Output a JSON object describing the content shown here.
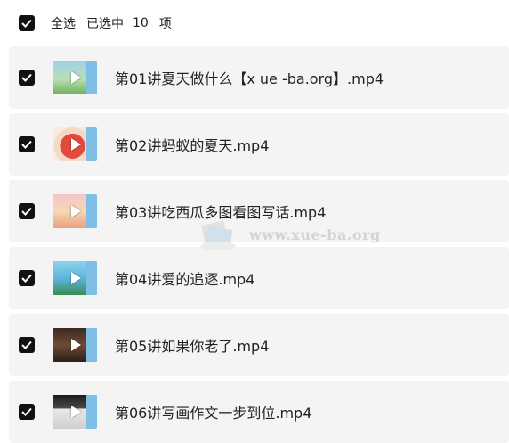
{
  "header": {
    "select_all_label": "全选",
    "selected_prefix": "已选中",
    "selected_count": "10",
    "selected_suffix": "项"
  },
  "items": [
    {
      "title": "第01讲夏天做什么【x ue -ba.org】.mp4",
      "checked": true
    },
    {
      "title": "第02讲蚂蚁的夏天.mp4",
      "checked": true
    },
    {
      "title": "第03讲吃西瓜多图看图写话.mp4",
      "checked": true
    },
    {
      "title": "第04讲爱的追逐.mp4",
      "checked": true
    },
    {
      "title": "第05讲如果你老了.mp4",
      "checked": true
    },
    {
      "title": "第06讲写画作文一步到位.mp4",
      "checked": true
    }
  ],
  "watermark": {
    "text": "www.xue-ba.org"
  },
  "colors": {
    "checkbox": "#111111",
    "row_background": "#f4f4f5",
    "text": "#222222"
  }
}
